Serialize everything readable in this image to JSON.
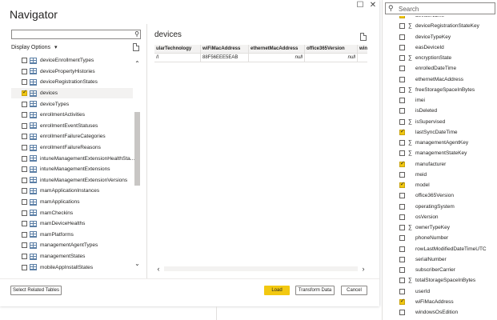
{
  "dialog": {
    "title": "Navigator",
    "display_options_label": "Display Options",
    "display_options_chevron": "▾",
    "buttons": {
      "select_related": "Select Related Tables",
      "load": "Load",
      "transform": "Transform Data",
      "cancel": "Cancel"
    }
  },
  "tree": {
    "items": [
      {
        "label": "deviceEnrollmentTypes",
        "checked": false
      },
      {
        "label": "devicePropertyHistories",
        "checked": false
      },
      {
        "label": "deviceRegistrationStates",
        "checked": false
      },
      {
        "label": "devices",
        "checked": true
      },
      {
        "label": "deviceTypes",
        "checked": false
      },
      {
        "label": "enrollmentActivities",
        "checked": false
      },
      {
        "label": "enrollmentEventStatuses",
        "checked": false
      },
      {
        "label": "enrollmentFailureCategories",
        "checked": false
      },
      {
        "label": "enrollmentFailureReasons",
        "checked": false
      },
      {
        "label": "intuneManagementExtensionHealthSta...",
        "checked": false
      },
      {
        "label": "intuneManagementExtensions",
        "checked": false
      },
      {
        "label": "intuneManagementExtensionVersions",
        "checked": false
      },
      {
        "label": "mamApplicationInstances",
        "checked": false
      },
      {
        "label": "mamApplications",
        "checked": false
      },
      {
        "label": "mamCheckins",
        "checked": false
      },
      {
        "label": "mamDeviceHealths",
        "checked": false
      },
      {
        "label": "mamPlatforms",
        "checked": false
      },
      {
        "label": "managementAgentTypes",
        "checked": false
      },
      {
        "label": "managementStates",
        "checked": false
      },
      {
        "label": "mobileAppInstallStates",
        "checked": false
      }
    ]
  },
  "preview": {
    "title": "devices",
    "columns": [
      "ularTechnology",
      "wiFiMacAddress",
      "ethernetMacAddress",
      "office365Version",
      "win"
    ],
    "row": [
      "/l",
      "88F56EEE5EAB",
      "null",
      "null",
      ""
    ]
  },
  "fields_panel": {
    "search_placeholder": "Search",
    "items": [
      {
        "label": "deviceName",
        "checked": true,
        "sigma": false
      },
      {
        "label": "deviceRegistrationStateKey",
        "checked": false,
        "sigma": true
      },
      {
        "label": "deviceTypeKey",
        "checked": false,
        "sigma": false
      },
      {
        "label": "easDeviceId",
        "checked": false,
        "sigma": false
      },
      {
        "label": "encryptionState",
        "checked": false,
        "sigma": true
      },
      {
        "label": "enrolledDateTime",
        "checked": false,
        "sigma": false
      },
      {
        "label": "ethernetMacAddress",
        "checked": false,
        "sigma": false
      },
      {
        "label": "freeStorageSpaceInBytes",
        "checked": false,
        "sigma": true
      },
      {
        "label": "imei",
        "checked": false,
        "sigma": false
      },
      {
        "label": "isDeleted",
        "checked": false,
        "sigma": false
      },
      {
        "label": "isSupervised",
        "checked": false,
        "sigma": true
      },
      {
        "label": "lastSyncDateTime",
        "checked": true,
        "sigma": false
      },
      {
        "label": "managementAgentKey",
        "checked": false,
        "sigma": true
      },
      {
        "label": "managementStateKey",
        "checked": false,
        "sigma": true
      },
      {
        "label": "manufacturer",
        "checked": true,
        "sigma": false
      },
      {
        "label": "meid",
        "checked": false,
        "sigma": false
      },
      {
        "label": "model",
        "checked": true,
        "sigma": false
      },
      {
        "label": "office365Version",
        "checked": false,
        "sigma": false
      },
      {
        "label": "operatingSystem",
        "checked": false,
        "sigma": false
      },
      {
        "label": "osVersion",
        "checked": false,
        "sigma": false
      },
      {
        "label": "ownerTypeKey",
        "checked": false,
        "sigma": true
      },
      {
        "label": "phoneNumber",
        "checked": false,
        "sigma": false
      },
      {
        "label": "rowLastModifiedDateTimeUTC",
        "checked": false,
        "sigma": false
      },
      {
        "label": "serialNumber",
        "checked": false,
        "sigma": false
      },
      {
        "label": "subscriberCarrier",
        "checked": false,
        "sigma": false
      },
      {
        "label": "totalStorageSpaceInBytes",
        "checked": false,
        "sigma": true
      },
      {
        "label": "userId",
        "checked": false,
        "sigma": false
      },
      {
        "label": "wiFiMacAddress",
        "checked": true,
        "sigma": false
      },
      {
        "label": "windowsOsEdition",
        "checked": false,
        "sigma": false
      }
    ]
  },
  "colors": {
    "accent": "#f2c811"
  }
}
